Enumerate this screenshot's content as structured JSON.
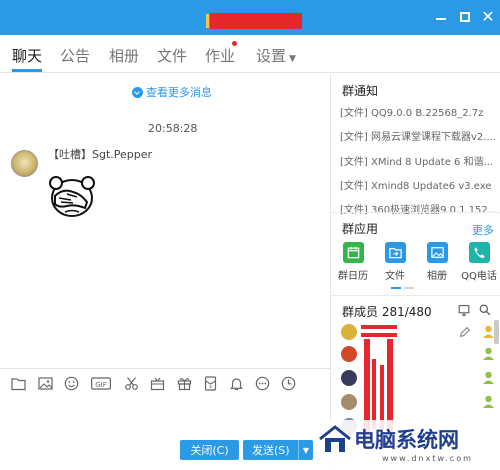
{
  "window": {
    "title": "",
    "controls": {
      "minimize": "minimize-icon",
      "maximize": "maximize-icon",
      "close": "close-icon"
    }
  },
  "tabs": [
    {
      "label": "聊天",
      "active": true
    },
    {
      "label": "公告"
    },
    {
      "label": "相册"
    },
    {
      "label": "文件"
    },
    {
      "label": "作业",
      "has_dot": true
    },
    {
      "label": "设置",
      "dropdown": true
    }
  ],
  "chat": {
    "more_messages": "查看更多消息",
    "timestamp": "20:58:28",
    "messages": [
      {
        "sender": "【吐槽】Sgt.Pepper",
        "content_type": "sticker",
        "sticker": "facepalm-sticker"
      }
    ]
  },
  "input_toolbar": [
    "folder-icon",
    "image-icon",
    "emoji-icon",
    "gif-icon",
    "scissors-icon",
    "gift-box-icon",
    "gift-icon",
    "redpacket-icon",
    "bell-icon",
    "more-icon",
    "clock-icon"
  ],
  "actions": {
    "close_label": "关闭(C)",
    "send_label": "发送(S)"
  },
  "sidebar": {
    "notice_title": "群通知",
    "notices": [
      "[文件] QQ9.0.0 B.22568_2.7z",
      "[文件] 网易云课堂课程下载器v2....",
      "[文件] XMind 8 Update 6 和谐...",
      "[文件] Xmind8 Update6 v3.exe",
      "[文件] 360极速浏览器9.0.1.152..."
    ],
    "apps_title": "群应用",
    "apps_more": "更多",
    "apps": [
      {
        "label": "群日历",
        "icon": "calendar-icon",
        "color": "#34b44a"
      },
      {
        "label": "文件",
        "icon": "file-share-icon",
        "color": "#2a9ae6"
      },
      {
        "label": "相册",
        "icon": "photo-icon",
        "color": "#2a9ae6"
      },
      {
        "label": "QQ电话",
        "icon": "phone-icon",
        "color": "#1fb4a8"
      }
    ],
    "members_title": "群成员 281/480",
    "members": [
      {
        "name": "",
        "avatar_color": "#d9b23a"
      },
      {
        "name": "",
        "avatar_color": "#d04a2a"
      },
      {
        "name": "",
        "avatar_color": "#3a3a5a"
      },
      {
        "name": "",
        "avatar_color": "#a58d6a"
      },
      {
        "name": "",
        "avatar_color": "#7a8a9a"
      }
    ]
  },
  "watermark": {
    "text": "电脑系统网",
    "url": "www.dnxtw.com"
  }
}
